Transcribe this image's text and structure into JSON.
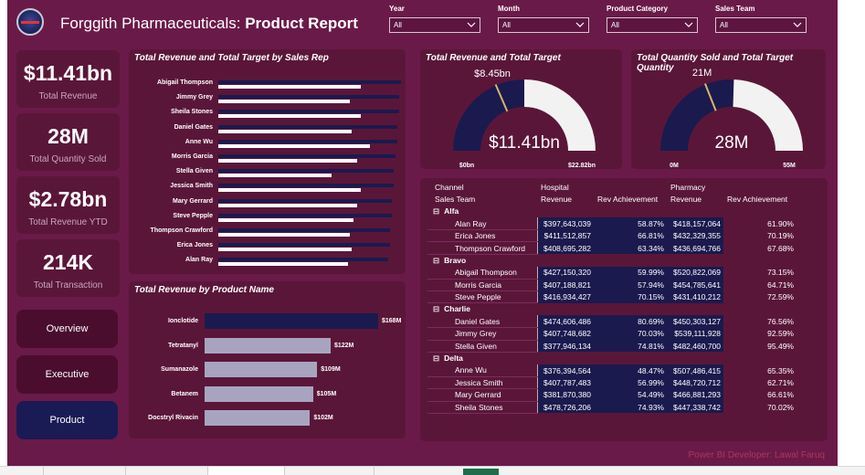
{
  "header": {
    "company": "Forggith Pharmaceuticals:",
    "report": "Product Report",
    "logo_text": "FORGGITH"
  },
  "filters": [
    {
      "label": "Year",
      "value": "All"
    },
    {
      "label": "Month",
      "value": "All"
    },
    {
      "label": "Product Category",
      "value": "All"
    },
    {
      "label": "Sales Team",
      "value": "All"
    }
  ],
  "kpis": [
    {
      "value": "$11.41bn",
      "label": "Total Revenue"
    },
    {
      "value": "28M",
      "label": "Total Quantity Sold"
    },
    {
      "value": "$2.78bn",
      "label": "Total Revenue YTD"
    },
    {
      "value": "214K",
      "label": "Total Transaction"
    }
  ],
  "nav": {
    "overview": "Overview",
    "executive": "Executive",
    "product": "Product"
  },
  "rep_chart": {
    "title": "Total Revenue and Total Target by Sales Rep",
    "reps": [
      {
        "name": "Abigail Thompson",
        "revenue": 0.78,
        "target": 1.0
      },
      {
        "name": "Jimmy Grey",
        "revenue": 0.72,
        "target": 0.99
      },
      {
        "name": "Sheila Stones",
        "revenue": 0.78,
        "target": 0.99
      },
      {
        "name": "Daniel Gates",
        "revenue": 0.73,
        "target": 0.98
      },
      {
        "name": "Anne Wu",
        "revenue": 0.83,
        "target": 0.98
      },
      {
        "name": "Morris Garcia",
        "revenue": 0.76,
        "target": 0.97
      },
      {
        "name": "Stella Given",
        "revenue": 0.62,
        "target": 0.96
      },
      {
        "name": "Jessica Smith",
        "revenue": 0.78,
        "target": 0.96
      },
      {
        "name": "Mary Gerrard",
        "revenue": 0.76,
        "target": 0.95
      },
      {
        "name": "Steve Pepple",
        "revenue": 0.74,
        "target": 0.95
      },
      {
        "name": "Thompson Crawford",
        "revenue": 0.72,
        "target": 0.94
      },
      {
        "name": "Erica Jones",
        "revenue": 0.73,
        "target": 0.94
      },
      {
        "name": "Alan Ray",
        "revenue": 0.71,
        "target": 0.93
      }
    ]
  },
  "chart_data": {
    "type": "bar",
    "title": "Total Revenue by Product Name",
    "categories": [
      "Ionclotide",
      "Tetratanyl",
      "Sumanazole",
      "Betanem",
      "Docstryl Rivacin"
    ],
    "values": [
      168,
      122,
      109,
      105,
      102
    ],
    "labels": [
      "$168M",
      "$122M",
      "$109M",
      "$105M",
      "$102M"
    ]
  },
  "gauge_revenue": {
    "title": "Total Revenue and Total Target",
    "value_label": "$11.41bn",
    "target_label": "$8.45bn",
    "min_label": "$0bn",
    "max_label": "$22.82bn",
    "fill_fraction": 0.5,
    "target_fraction": 0.37
  },
  "gauge_quantity": {
    "title": "Total Quantity Sold and Total Target Quantity",
    "value_label": "28M",
    "target_label": "21M",
    "min_label": "0M",
    "max_label": "55M",
    "fill_fraction": 0.51,
    "target_fraction": 0.38
  },
  "matrix": {
    "h_channel": "Channel",
    "h_team": "Sales Team",
    "h_hospital": "Hospital",
    "h_pharmacy": "Pharmacy",
    "h_revenue": "Revenue",
    "h_ach": "Rev Achievement",
    "collapse": "⊟",
    "groups": [
      {
        "name": "Alfa",
        "rows": [
          [
            "Alan Ray",
            "$397,643,039",
            "58.87%",
            "$418,157,064",
            "61.90%"
          ],
          [
            "Erica Jones",
            "$411,512,857",
            "66.81%",
            "$432,329,355",
            "70.19%"
          ],
          [
            "Thompson Crawford",
            "$408,695,282",
            "63.34%",
            "$436,694,766",
            "67.68%"
          ]
        ]
      },
      {
        "name": "Bravo",
        "rows": [
          [
            "Abigail Thompson",
            "$427,150,320",
            "59.99%",
            "$520,822,069",
            "73.15%"
          ],
          [
            "Morris Garcia",
            "$407,188,821",
            "57.94%",
            "$454,785,641",
            "64.71%"
          ],
          [
            "Steve Pepple",
            "$416,934,427",
            "70.15%",
            "$431,410,212",
            "72.59%"
          ]
        ]
      },
      {
        "name": "Charlie",
        "rows": [
          [
            "Daniel Gates",
            "$474,606,486",
            "80.69%",
            "$450,303,127",
            "76.56%"
          ],
          [
            "Jimmy Grey",
            "$407,748,682",
            "70.03%",
            "$539,111,928",
            "92.59%"
          ],
          [
            "Stella Given",
            "$377,946,134",
            "74.81%",
            "$482,460,700",
            "95.49%"
          ]
        ]
      },
      {
        "name": "Delta",
        "rows": [
          [
            "Anne Wu",
            "$376,394,564",
            "48.47%",
            "$507,486,415",
            "65.35%"
          ],
          [
            "Jessica Smith",
            "$407,787,483",
            "56.99%",
            "$448,720,712",
            "62.71%"
          ],
          [
            "Mary Gerrard",
            "$381,870,380",
            "54.49%",
            "$466,881,293",
            "66.61%"
          ],
          [
            "Sheila Stones",
            "$478,726,206",
            "74.93%",
            "$447,338,742",
            "70.02%"
          ]
        ]
      }
    ]
  },
  "footer": "Power BI Developer: Lawal Faruq",
  "colors": {
    "background": "#6a1a48",
    "panel": "#5a1639",
    "navy": "#1a1a4e",
    "bar_light": "#a8a4c0",
    "target_marker": "#d9b46a"
  }
}
